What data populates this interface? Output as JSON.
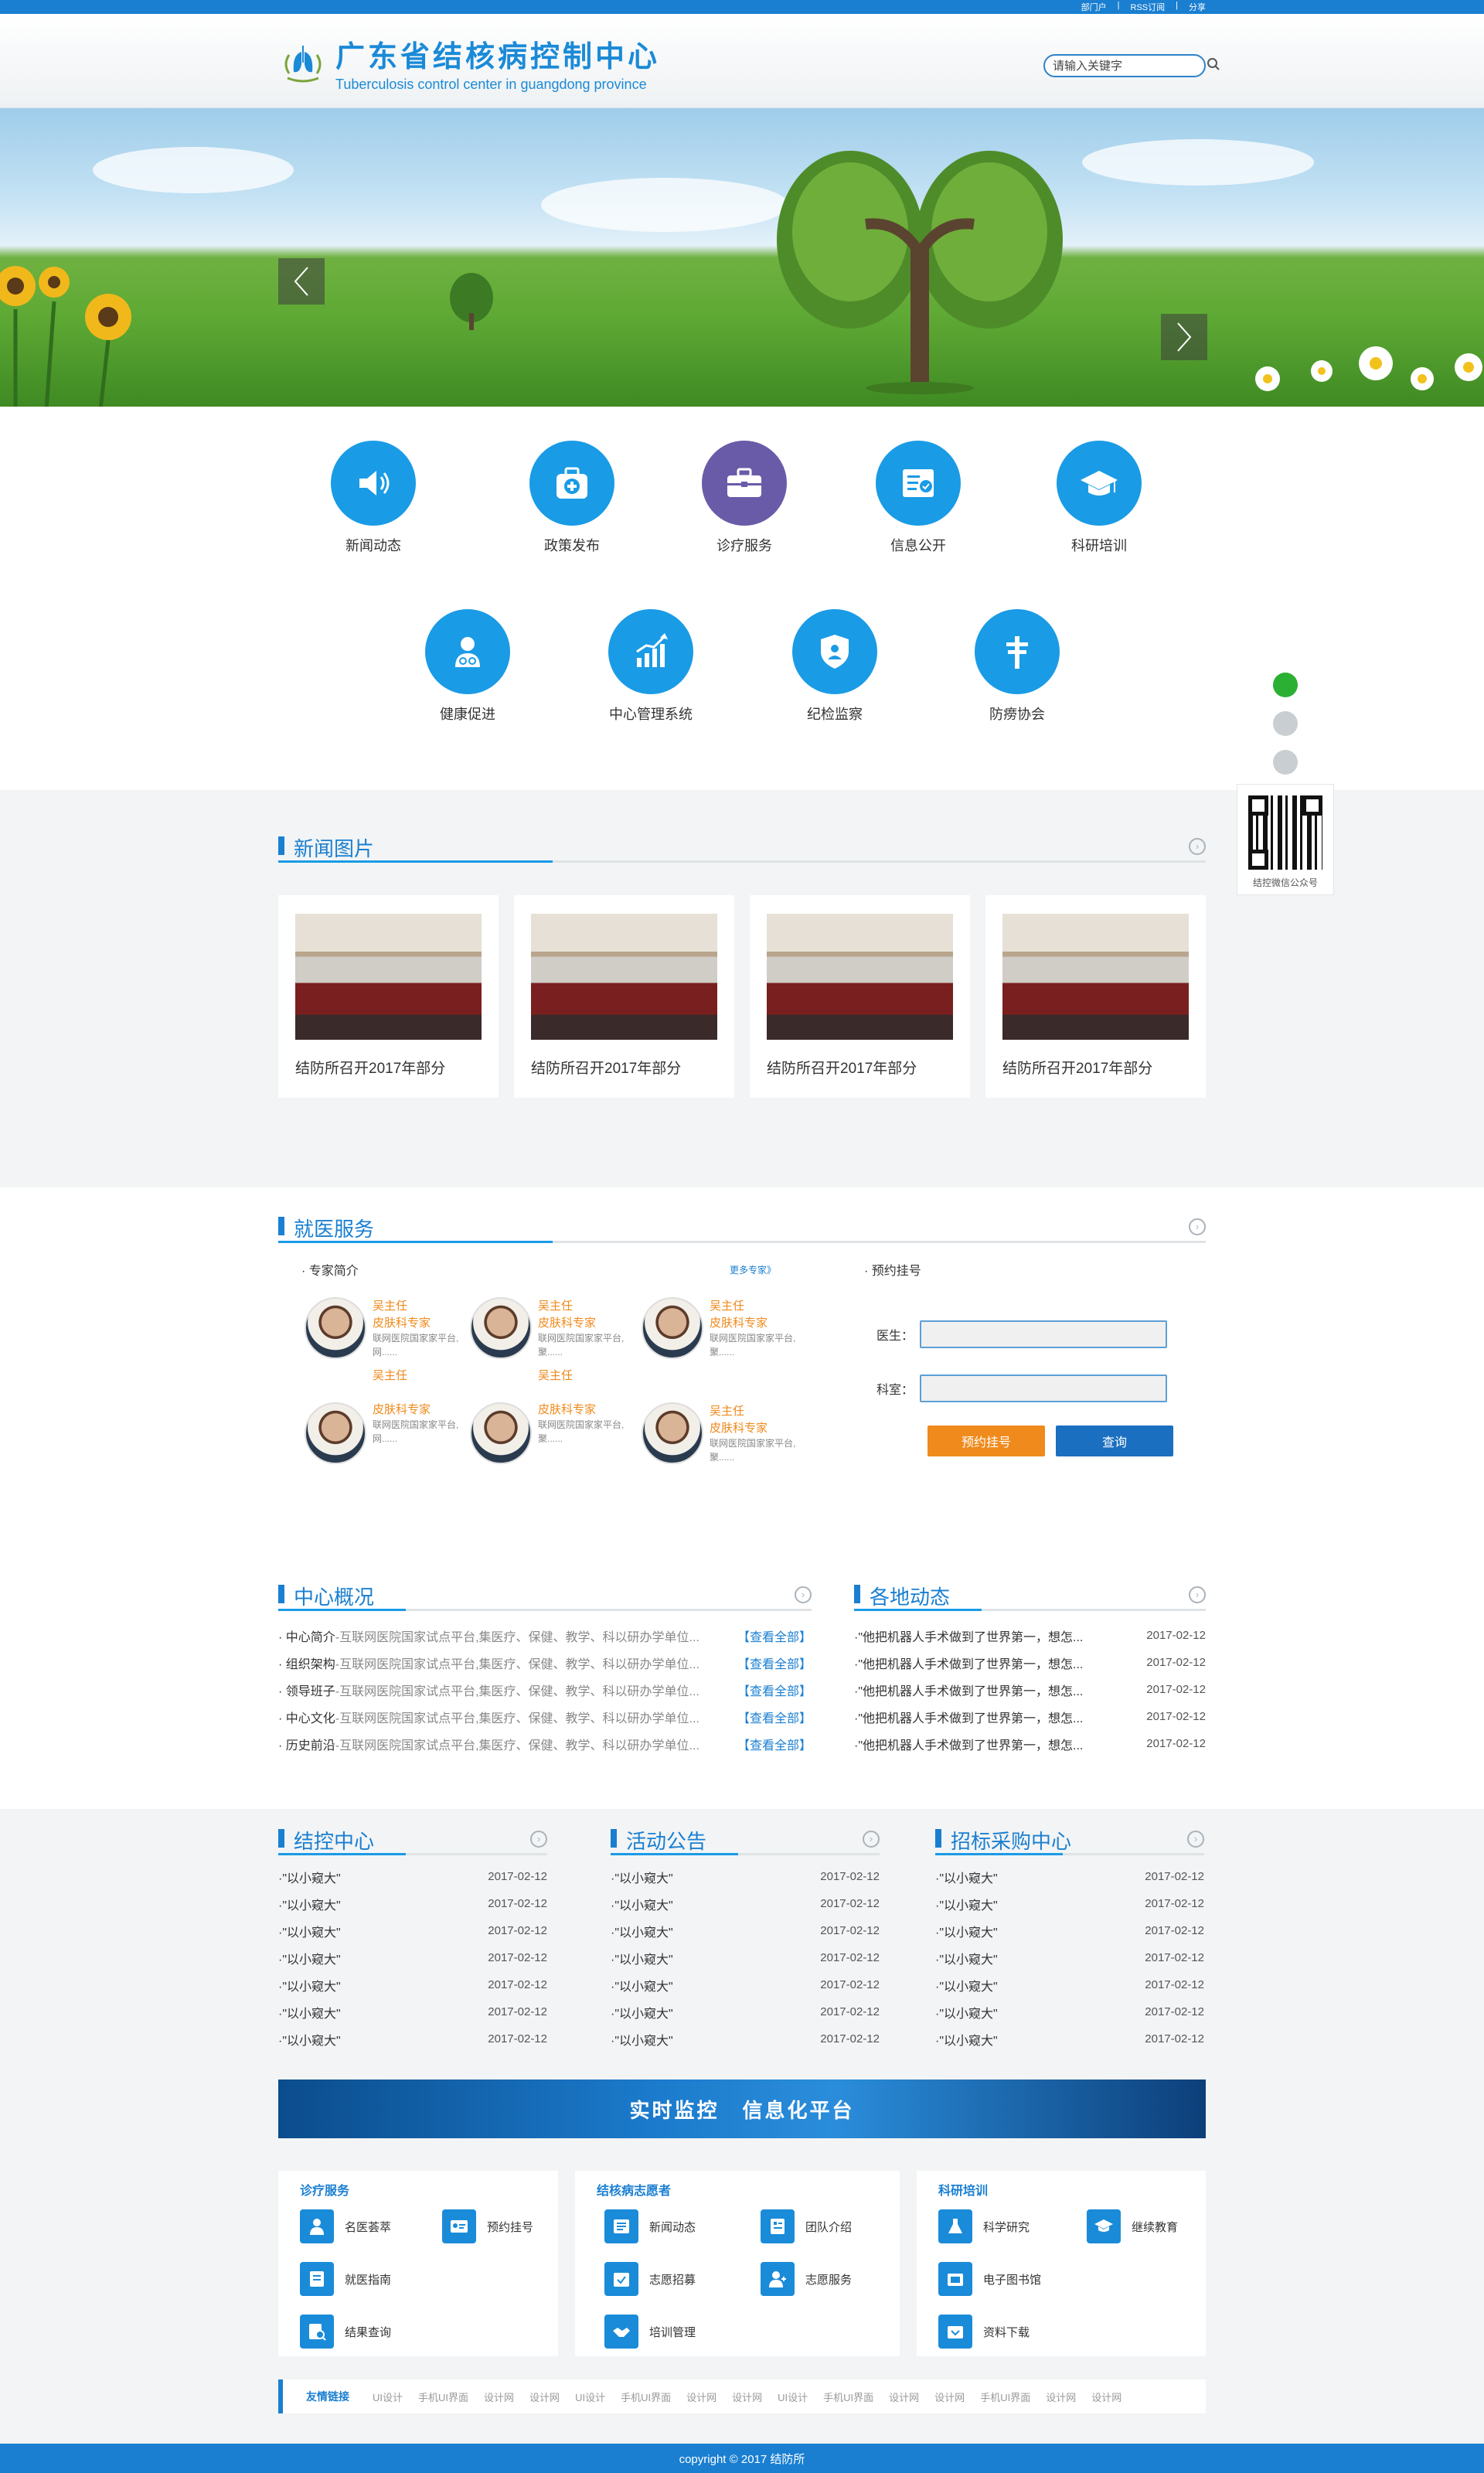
{
  "topbar": {
    "links": [
      "部门户",
      "RSS订阅",
      "分享"
    ]
  },
  "header": {
    "title_cn": "广东省结核病控制中心",
    "title_en": "Tuberculosis control center in guangdong province",
    "search_placeholder": "请输入关键字"
  },
  "quick_links": [
    {
      "label": "新闻动态",
      "icon": "speaker-icon"
    },
    {
      "label": "政策发布",
      "icon": "medical-kit-icon"
    },
    {
      "label": "诊疗服务",
      "icon": "briefcase-icon"
    },
    {
      "label": "信息公开",
      "icon": "certificate-icon"
    },
    {
      "label": "科研培训",
      "icon": "graduation-cap-icon"
    },
    {
      "label": "健康促进",
      "icon": "doctor-icon"
    },
    {
      "label": "中心管理系统",
      "icon": "growth-chart-icon"
    },
    {
      "label": "纪检监察",
      "icon": "shield-icon"
    },
    {
      "label": "防痨协会",
      "icon": "cross-icon"
    }
  ],
  "news_photos": {
    "title": "新闻图片",
    "items": [
      "结防所召开2017年部分",
      "结防所召开2017年部分",
      "结防所召开2017年部分",
      "结防所召开2017年部分"
    ]
  },
  "medical": {
    "title": "就医服务",
    "experts_title": "· 专家简介",
    "more_experts": "更多专家》",
    "experts": [
      {
        "name": "吴主任",
        "title": "皮肤科专家",
        "desc": "联网医院国家家平台,网......"
      },
      {
        "name": "吴主任",
        "title": "皮肤科专家",
        "desc": "联网医院国家家平台,聚......"
      },
      {
        "name": "吴主任",
        "title": "皮肤科专家",
        "desc": "联网医院国家家平台,聚......"
      },
      {
        "name": "吴主任",
        "title": "皮肤科专家",
        "desc": "联网医院国家家平台,网......"
      },
      {
        "name": "吴主任",
        "title": "皮肤科专家",
        "desc": "联网医院国家家平台,聚......"
      },
      {
        "name": "吴主任",
        "title": "皮肤科专家",
        "desc": "联网医院国家家平台,聚......"
      }
    ],
    "appointment_title": "· 预约挂号",
    "doctor_label": "医生：",
    "dept_label": "科室：",
    "book_button": "预约挂号",
    "query_button": "查询"
  },
  "overview": {
    "title": "中心概况",
    "items": [
      {
        "label": "· 中心简介",
        "desc": "-互联网医院国家试点平台,集医疗、保健、教学、科以研办学单位...",
        "link": "【查看全部】"
      },
      {
        "label": "· 组织架构",
        "desc": "-互联网医院国家试点平台,集医疗、保健、教学、科以研办学单位...",
        "link": "【查看全部】"
      },
      {
        "label": "· 领导班子",
        "desc": "-互联网医院国家试点平台,集医疗、保健、教学、科以研办学单位...",
        "link": "【查看全部】"
      },
      {
        "label": "· 中心文化",
        "desc": "-互联网医院国家试点平台,集医疗、保健、教学、科以研办学单位...",
        "link": "【查看全部】"
      },
      {
        "label": "· 历史前沿",
        "desc": "-互联网医院国家试点平台,集医疗、保健、教学、科以研办学单位...",
        "link": "【查看全部】"
      }
    ]
  },
  "regional": {
    "title": "各地动态",
    "items": [
      {
        "text": "·\"他把机器人手术做到了世界第一，想怎...",
        "date": "2017-02-12"
      },
      {
        "text": "·\"他把机器人手术做到了世界第一，想怎...",
        "date": "2017-02-12"
      },
      {
        "text": "·\"他把机器人手术做到了世界第一，想怎...",
        "date": "2017-02-12"
      },
      {
        "text": "·\"他把机器人手术做到了世界第一，想怎...",
        "date": "2017-02-12"
      },
      {
        "text": "·\"他把机器人手术做到了世界第一，想怎...",
        "date": "2017-02-12"
      }
    ]
  },
  "three_cols": [
    {
      "title": "结控中心",
      "items": [
        "·\"以小窥大\"",
        "·\"以小窥大\"",
        "·\"以小窥大\"",
        "·\"以小窥大\"",
        "·\"以小窥大\"",
        "·\"以小窥大\"",
        "·\"以小窥大\""
      ],
      "date": "2017-02-12"
    },
    {
      "title": "活动公告",
      "items": [
        "·\"以小窥大\"",
        "·\"以小窥大\"",
        "·\"以小窥大\"",
        "·\"以小窥大\"",
        "·\"以小窥大\"",
        "·\"以小窥大\"",
        "·\"以小窥大\""
      ],
      "date": "2017-02-12"
    },
    {
      "title": "招标采购中心",
      "items": [
        "·\"以小窥大\"",
        "·\"以小窥大\"",
        "·\"以小窥大\"",
        "·\"以小窥大\"",
        "·\"以小窥大\"",
        "·\"以小窥大\"",
        "·\"以小窥大\""
      ],
      "date": "2017-02-12"
    }
  ],
  "platform_banner": {
    "text1": "实时监控",
    "text2": "信息化平台"
  },
  "services": [
    {
      "title": "诊疗服务",
      "items": [
        "名医荟萃",
        "预约挂号",
        "就医指南",
        "结果查询"
      ]
    },
    {
      "title": "结核病志愿者",
      "items": [
        "新闻动态",
        "团队介绍",
        "志愿招募",
        "志愿服务",
        "培训管理"
      ]
    },
    {
      "title": "科研培训",
      "items": [
        "科学研究",
        "继续教育",
        "电子图书馆",
        "资料下载"
      ]
    }
  ],
  "friend_links": {
    "title": "友情链接",
    "items": [
      "UI设计",
      "手机UI界面",
      "设计网",
      "设计网",
      "UI设计",
      "手机UI界面",
      "设计网",
      "设计网",
      "UI设计",
      "手机UI界面",
      "设计网",
      "设计网",
      "手机UI界面",
      "设计网",
      "设计网"
    ]
  },
  "side": {
    "qr_caption": "结控微信公众号"
  },
  "footer": {
    "copyright": "copyright © 2017 结防所"
  },
  "colors": {
    "primary": "#1a7fd1",
    "accent": "#1a9be6",
    "orange": "#f08a1c",
    "purple": "#6a5ba8"
  }
}
